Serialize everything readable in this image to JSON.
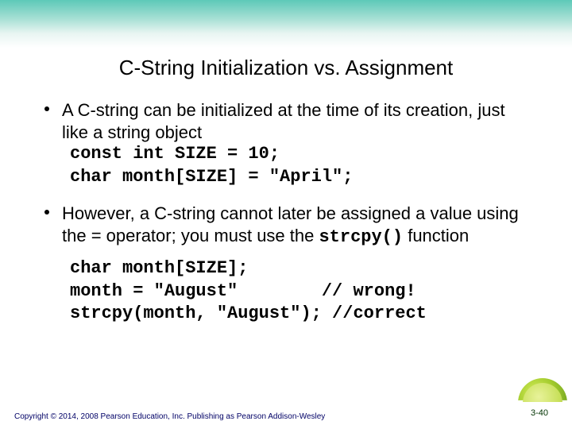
{
  "title": "C-String Initialization vs. Assignment",
  "bullets": [
    {
      "text": "A C-string can be initialized at the time of its creation, just like a string object",
      "code": "const int SIZE = 10;\nchar month[SIZE] = \"April\";"
    },
    {
      "text_parts": [
        "However, a C-string cannot later be assigned a value using the = operator; you must use the ",
        "strcpy()",
        " function"
      ],
      "code": "char month[SIZE];\nmonth = \"August\"        // wrong!\nstrcpy(month, \"August\"); //correct"
    }
  ],
  "footer": "Copyright © 2014, 2008 Pearson Education, Inc. Publishing as Pearson Addison-Wesley",
  "slide_number": "3-40"
}
